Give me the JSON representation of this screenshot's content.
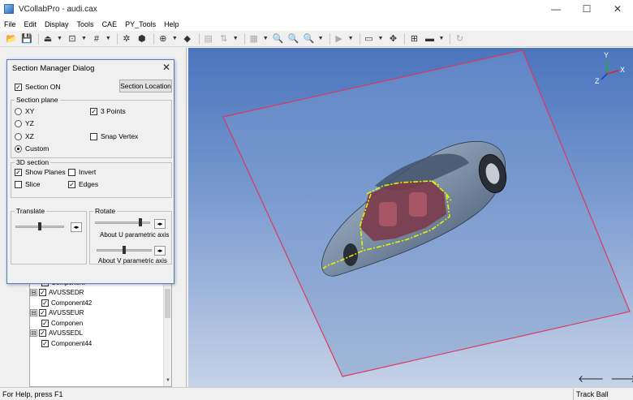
{
  "window": {
    "title": "VCollabPro - audi.cax",
    "minimize": "—",
    "maximize": "☐",
    "close": "✕"
  },
  "menu": [
    "File",
    "Edit",
    "Display",
    "Tools",
    "CAE",
    "PY_Tools",
    "Help"
  ],
  "dialog": {
    "title": "Section Manager Dialog",
    "close": "✕",
    "section_on": "Section ON",
    "section_location": "Section Location",
    "section_plane_label": "Section plane",
    "plane_options": [
      {
        "label": "XY",
        "checked": false
      },
      {
        "label": "YZ",
        "checked": false
      },
      {
        "label": "XZ",
        "checked": false
      },
      {
        "label": "Custom",
        "checked": true
      }
    ],
    "three_points": "3 Points",
    "snap_vertex": "Snap Vertex",
    "section_3d_label": "3D section",
    "show_planes": "Show Planes",
    "invert": "Invert",
    "slice": "Slice",
    "edges": "Edges",
    "translate_label": "Translate",
    "rotate_label": "Rotate",
    "about_u": "About U parametric axis",
    "about_v": "About V parametric axis"
  },
  "tree": [
    {
      "indent": 1,
      "label": "Component",
      "expander": "",
      "checked": true
    },
    {
      "indent": 0,
      "label": "AVUSSEDR",
      "expander": "⊟",
      "checked": true
    },
    {
      "indent": 1,
      "label": "Component42",
      "expander": "",
      "checked": true
    },
    {
      "indent": 0,
      "label": "AVUSSEUR",
      "expander": "⊟",
      "checked": true
    },
    {
      "indent": 1,
      "label": "Componen",
      "expander": "",
      "checked": true
    },
    {
      "indent": 0,
      "label": "AVUSSEDL",
      "expander": "⊟",
      "checked": true
    },
    {
      "indent": 1,
      "label": "Component44",
      "expander": "",
      "checked": true
    }
  ],
  "viewport": {
    "axis_labels": {
      "x": "X",
      "y": "Y",
      "z": "Z"
    }
  },
  "status": {
    "help_text": "For Help, press F1",
    "mode": "Track Ball"
  },
  "colors": {
    "viewport_top": "#4a74bd",
    "plane_border": "#e0345a",
    "section_edge": "#e6f000",
    "interior": "#7a3a4a"
  }
}
